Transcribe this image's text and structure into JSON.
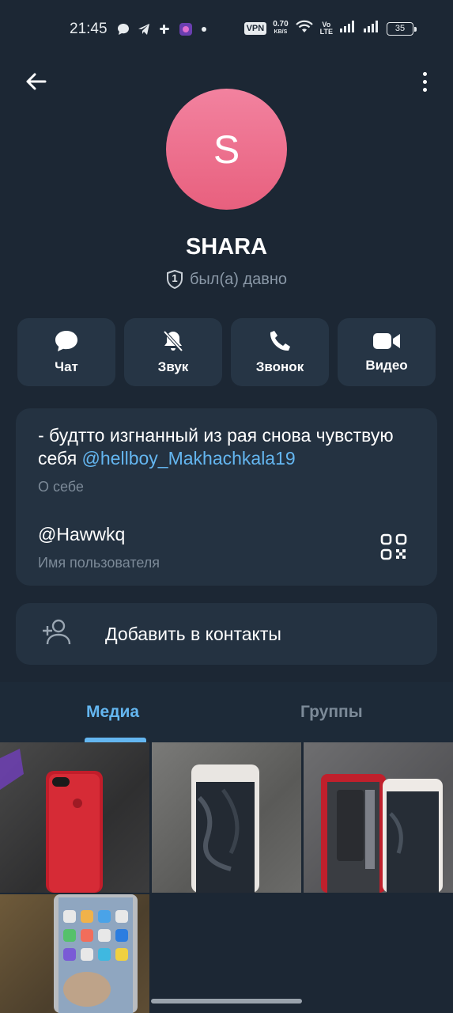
{
  "status_bar": {
    "time": "21:45",
    "vpn": "VPN",
    "net_speed_value": "0.70",
    "net_speed_unit": "KB/S",
    "volte_top": "Vo",
    "volte_mid": "LTE",
    "battery": "35"
  },
  "profile": {
    "avatar_letter": "S",
    "avatar_color": "#ec6f8d",
    "name": "SHARA",
    "last_seen": "был(а) давно",
    "badge_number": "1"
  },
  "actions": [
    {
      "label": "Чат",
      "icon": "chat-icon"
    },
    {
      "label": "Звук",
      "icon": "bell-off-icon"
    },
    {
      "label": "Звонок",
      "icon": "phone-icon"
    },
    {
      "label": "Видео",
      "icon": "video-icon"
    }
  ],
  "info": {
    "bio_text": "- будтто изгнанный из рая снова чувствую себя ",
    "bio_mention": "@hellboy_Makhachkala19",
    "bio_label": "О себе",
    "username": "@Hawwkq",
    "username_label": "Имя пользователя"
  },
  "add_contact": {
    "label": "Добавить в контакты"
  },
  "tabs": {
    "media": "Медиа",
    "groups": "Группы",
    "active": "media"
  },
  "colors": {
    "background": "#1c2734",
    "card": "#243241",
    "accent": "#64b6f0",
    "muted": "#7c8a98"
  }
}
